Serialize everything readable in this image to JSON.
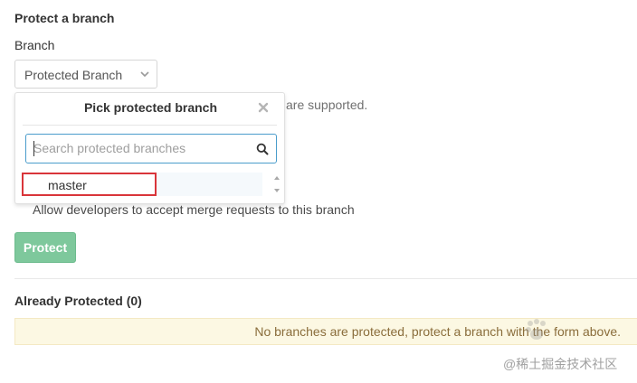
{
  "form": {
    "section_title": "Protect a branch",
    "branch_label": "Branch",
    "dropdown_value": "Protected Branch",
    "hint_text": "are supported."
  },
  "menu": {
    "title": "Pick protected branch",
    "search_placeholder": "Search protected branches",
    "search_value": "",
    "items": [
      {
        "label": "master",
        "highlighted": true
      }
    ]
  },
  "allow_text": "Allow developers to accept merge requests to this branch",
  "protect_button_label": "Protect",
  "already": {
    "title": "Already Protected (0)",
    "empty_message": "No branches are protected, protect a branch with the form above."
  },
  "watermark": "@稀土掘金技术社区",
  "colors": {
    "protect_button": "#7ec89c",
    "highlight_border": "#d9353a",
    "search_border": "#4a9ccb",
    "banner_bg": "#fcf8e3",
    "banner_text": "#8a6d3b"
  },
  "icons": [
    "chevron-down-icon",
    "close-icon",
    "search-icon",
    "scroll-up-icon",
    "scroll-down-icon"
  ]
}
